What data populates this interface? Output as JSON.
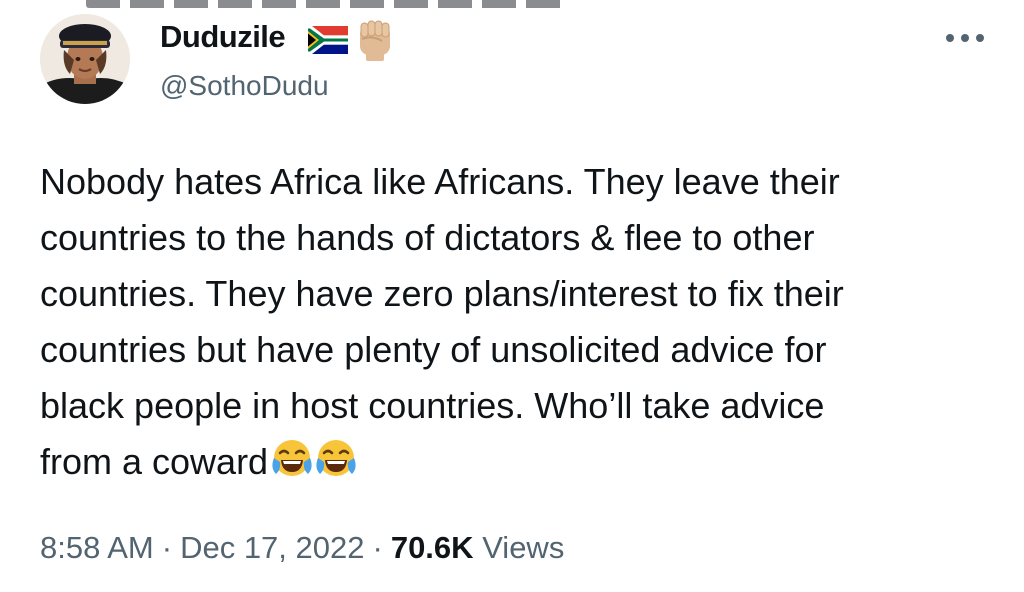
{
  "tweet": {
    "author": {
      "display_name": "Duduzile",
      "handle": "@SothoDudu",
      "badges": [
        "south-africa-flag-icon",
        "raised-fist-icon"
      ],
      "avatar": "avatar-photo"
    },
    "more_menu": "more-options-icon",
    "text_lines": [
      "Nobody hates Africa like Africans. They leave their",
      "countries to the hands of dictators & flee to other",
      "countries. They have zero plans/interest to fix their",
      "countries but have plenty of unsolicited advice for",
      "black people in host countries. Who’ll take advice",
      "from a coward"
    ],
    "trailing_emojis": [
      "tears-of-joy-emoji",
      "tears-of-joy-emoji"
    ],
    "time": "8:58 AM",
    "separator": "·",
    "date": "Dec 17, 2022",
    "views_count": "70.6K",
    "views_label": "Views"
  },
  "colors": {
    "text": "#0f1419",
    "secondary_text": "#536471",
    "background": "#ffffff"
  }
}
